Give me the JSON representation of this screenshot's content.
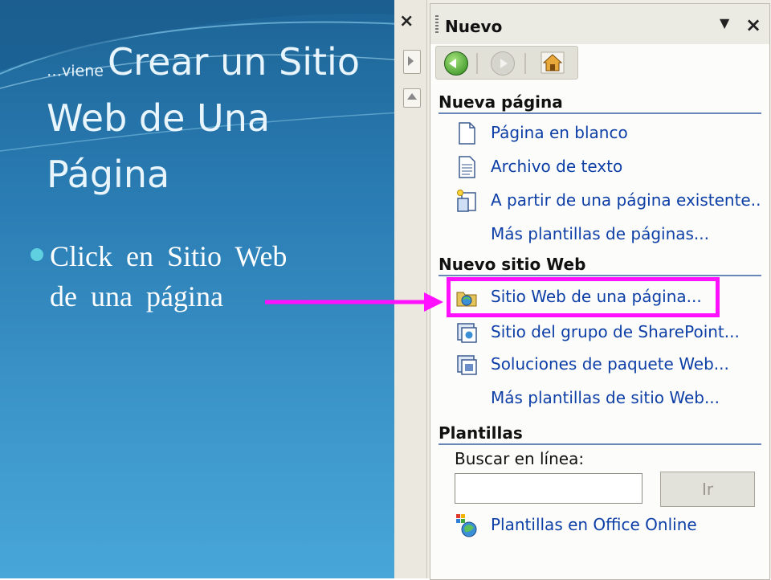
{
  "slide": {
    "title_prefix": "…viene",
    "title_line1": "Crear un Sitio",
    "title_line2": "Web de Una",
    "title_line3": "Página",
    "bullet_line1": "Click en Sitio Web",
    "bullet_line2": "de una página"
  },
  "pane": {
    "strip_close": "×",
    "title": "Nuevo",
    "menu_glyph": "▼",
    "close_glyph": "×",
    "sections": {
      "nueva_pagina": "Nueva página",
      "nuevo_sitio": "Nuevo sitio Web",
      "plantillas": "Plantillas"
    },
    "items": {
      "blank": "Página en blanco",
      "text_file": "Archivo de texto",
      "from_existing": "A partir de una página existente..",
      "more_page_templates": "Más plantillas de páginas...",
      "one_page_site": "Sitio Web de una página...",
      "sharepoint": "Sitio del grupo de SharePoint...",
      "web_package": "Soluciones de paquete Web...",
      "more_site_templates": "Más plantillas de sitio Web...",
      "office_online": "Plantillas en Office Online"
    },
    "search": {
      "label": "Buscar en línea:",
      "value": "",
      "button": "Ir"
    }
  },
  "colors": {
    "link": "#0d3fa6",
    "highlight": "#ff10ff",
    "section_rule": "#6b86b8"
  }
}
